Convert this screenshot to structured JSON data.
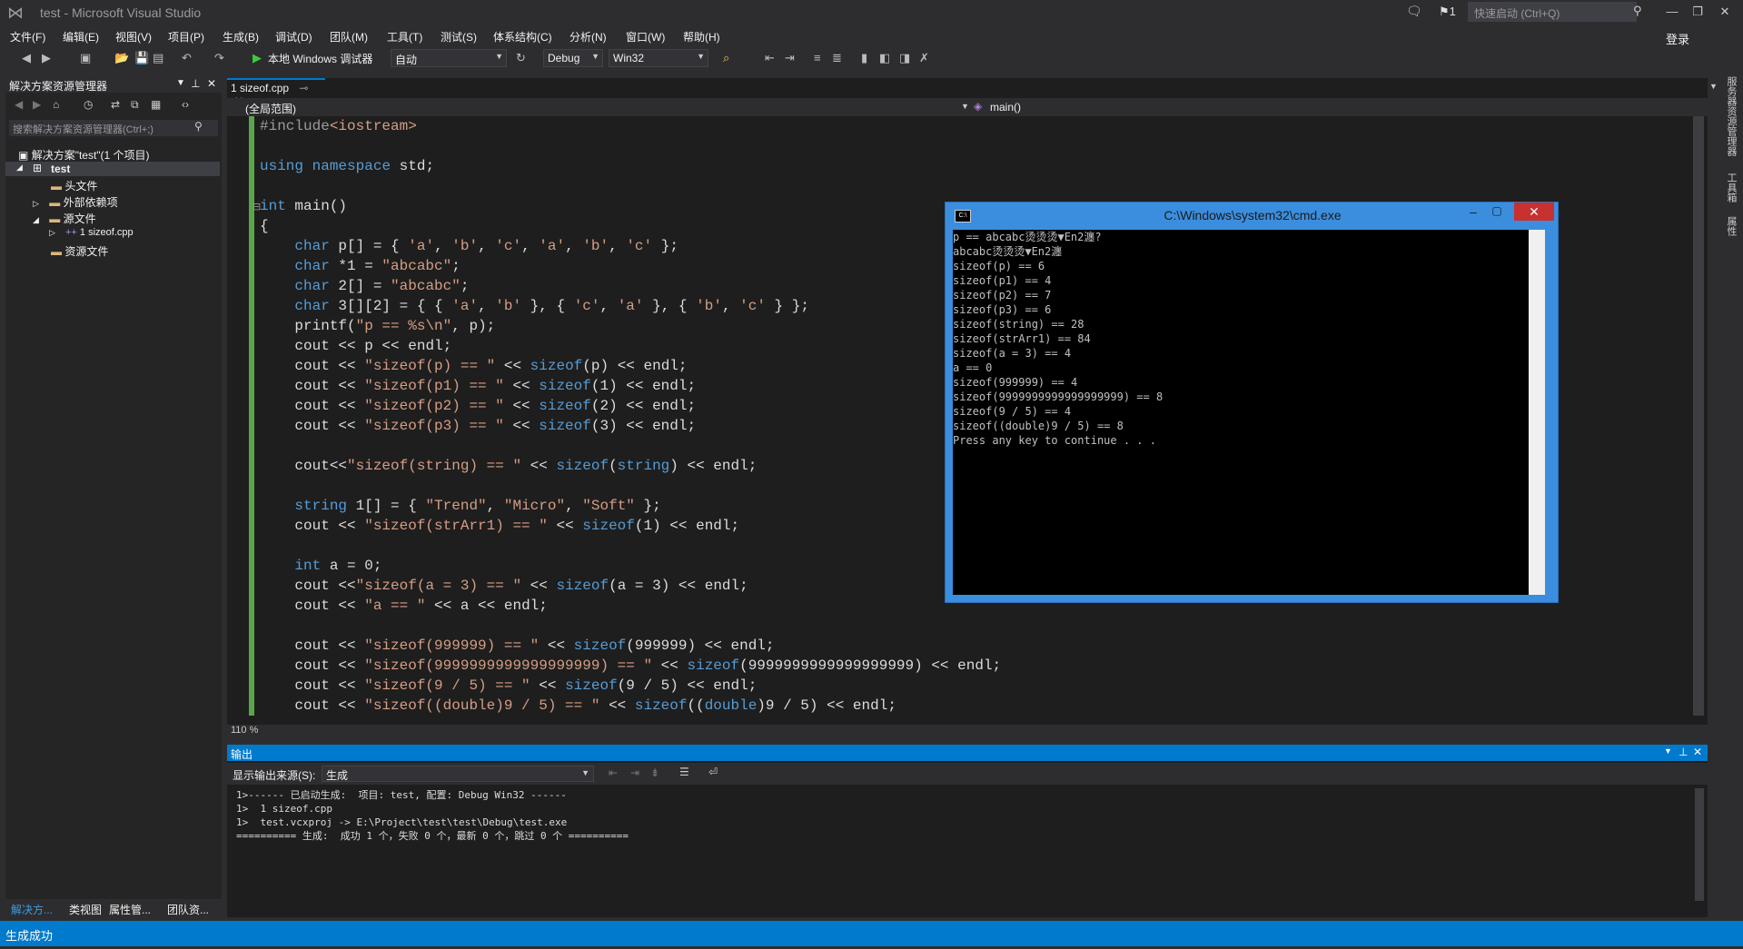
{
  "window": {
    "title": "test - Microsoft Visual Studio",
    "notification_count": "1",
    "quick_launch_placeholder": "快速启动 (Ctrl+Q)",
    "login": "登录"
  },
  "menu": [
    "文件(F)",
    "编辑(E)",
    "视图(V)",
    "项目(P)",
    "生成(B)",
    "调试(D)",
    "团队(M)",
    "工具(T)",
    "测试(S)",
    "体系结构(C)",
    "分析(N)",
    "窗口(W)",
    "帮助(H)"
  ],
  "toolbar": {
    "start_debug": "本地 Windows 调试器",
    "auto": "自动",
    "config": "Debug",
    "platform": "Win32"
  },
  "solution_explorer": {
    "title": "解决方案资源管理器",
    "search_placeholder": "搜索解决方案资源管理器(Ctrl+;)",
    "solution": "解决方案\"test\"(1 个项目)",
    "project": "test",
    "items": {
      "headers": "头文件",
      "external": "外部依赖项",
      "sources": "源文件",
      "file": "1 sizeof.cpp",
      "resources": "资源文件"
    },
    "tabs": [
      "解决方...",
      "类视图",
      "属性管...",
      "团队资..."
    ]
  },
  "editor": {
    "tab": "1 sizeof.cpp",
    "scope": "(全局范围)",
    "function": "main()",
    "zoom": "110 %"
  },
  "code_lines": [
    "#include<iostream>",
    "",
    "using namespace std;",
    "",
    "int main()",
    "{",
    "    char p[] = { 'a', 'b', 'c', 'a', 'b', 'c' };",
    "    char *p1 = \"abcabc\";",
    "    char p2[] = \"abcabc\";",
    "    char p3[][2] = { { 'a', 'b' }, { 'c', 'a' }, { 'b', 'c' } };",
    "    printf(\"p == %s\\n\", p);",
    "    cout << p << endl;",
    "    cout << \"sizeof(p) == \" << sizeof(p) << endl;",
    "    cout << \"sizeof(p1) == \" << sizeof(p1) << endl;",
    "    cout << \"sizeof(p2) == \" << sizeof(p2) << endl;",
    "    cout << \"sizeof(p3) == \" << sizeof(p3) << endl;",
    "",
    "    cout<<\"sizeof(string) == \" << sizeof(string) << endl;",
    "",
    "    string strArr1[] = { \"Trend\", \"Micro\", \"Soft\" };",
    "    cout << \"sizeof(strArr1) == \" << sizeof(strArr1) << endl;",
    "",
    "    int a = 0;",
    "    cout <<\"sizeof(a = 3) == \" << sizeof(a = 3) << endl;",
    "    cout << \"a == \" << a << endl;",
    "",
    "    cout << \"sizeof(999999) == \" << sizeof(999999) << endl;",
    "    cout << \"sizeof(9999999999999999999) == \" << sizeof(9999999999999999999) << endl;",
    "    cout << \"sizeof(9 / 5) == \" << sizeof(9 / 5) << endl;",
    "    cout << \"sizeof((double)9 / 5) == \" << sizeof((double)9 / 5) << endl;"
  ],
  "cmd": {
    "title": "C:\\Windows\\system32\\cmd.exe",
    "output": "p == abcabc烫烫烫▼En2瀍?\nabcabc烫烫烫▼En2瀍\nsizeof(p) == 6\nsizeof(p1) == 4\nsizeof(p2) == 7\nsizeof(p3) == 6\nsizeof(string) == 28\nsizeof(strArr1) == 84\nsizeof(a = 3) == 4\na == 0\nsizeof(999999) == 4\nsizeof(9999999999999999999) == 8\nsizeof(9 / 5) == 4\nsizeof((double)9 / 5) == 8\nPress any key to continue . . ."
  },
  "output_panel": {
    "title": "输出",
    "source_label": "显示输出来源(S):",
    "source_value": "生成",
    "text": "1>------ 已启动生成:  项目: test, 配置: Debug Win32 ------\n1>  1 sizeof.cpp\n1>  test.vcxproj -> E:\\Project\\test\\test\\Debug\\test.exe\n========== 生成:  成功 1 个，失败 0 个，最新 0 个，跳过 0 个 =========="
  },
  "right_rail": [
    "服务器资源管理器",
    "工具箱",
    "属性"
  ],
  "status": "生成成功"
}
